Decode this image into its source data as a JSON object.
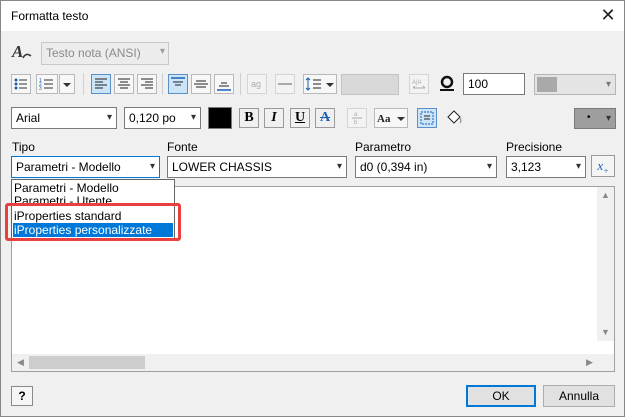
{
  "window": {
    "title": "Formatta testo",
    "close_glyph": "✕"
  },
  "style_row": {
    "style_icon": "text-style-icon",
    "style_value": "Testo nota (ANSI)"
  },
  "paragraph_row": {
    "spacing_value": "100"
  },
  "font_row": {
    "font_value": "Arial",
    "size_value": "0,120 po",
    "bold": "B",
    "italic": "I",
    "underline": "U",
    "strike": "A",
    "case": "Aa",
    "text_color": "#000000"
  },
  "labels": {
    "type": "Tipo",
    "source": "Fonte",
    "parameter": "Parametro",
    "precision": "Precisione"
  },
  "fields": {
    "type_value": "Parametri - Modello",
    "source_value": "LOWER CHASSIS",
    "parameter_value": "d0 (0,394 in)",
    "precision_value": "3,123"
  },
  "type_dropdown": {
    "items": [
      "Parametri - Modello",
      "Parametri - Utente",
      "iProperties standard",
      "iProperties personalizzate"
    ],
    "selected_index": 3
  },
  "highlight_color": "#e8403e",
  "accent_color": "#0078d7",
  "buttons": {
    "help": "?",
    "ok": "OK",
    "cancel": "Annulla"
  }
}
